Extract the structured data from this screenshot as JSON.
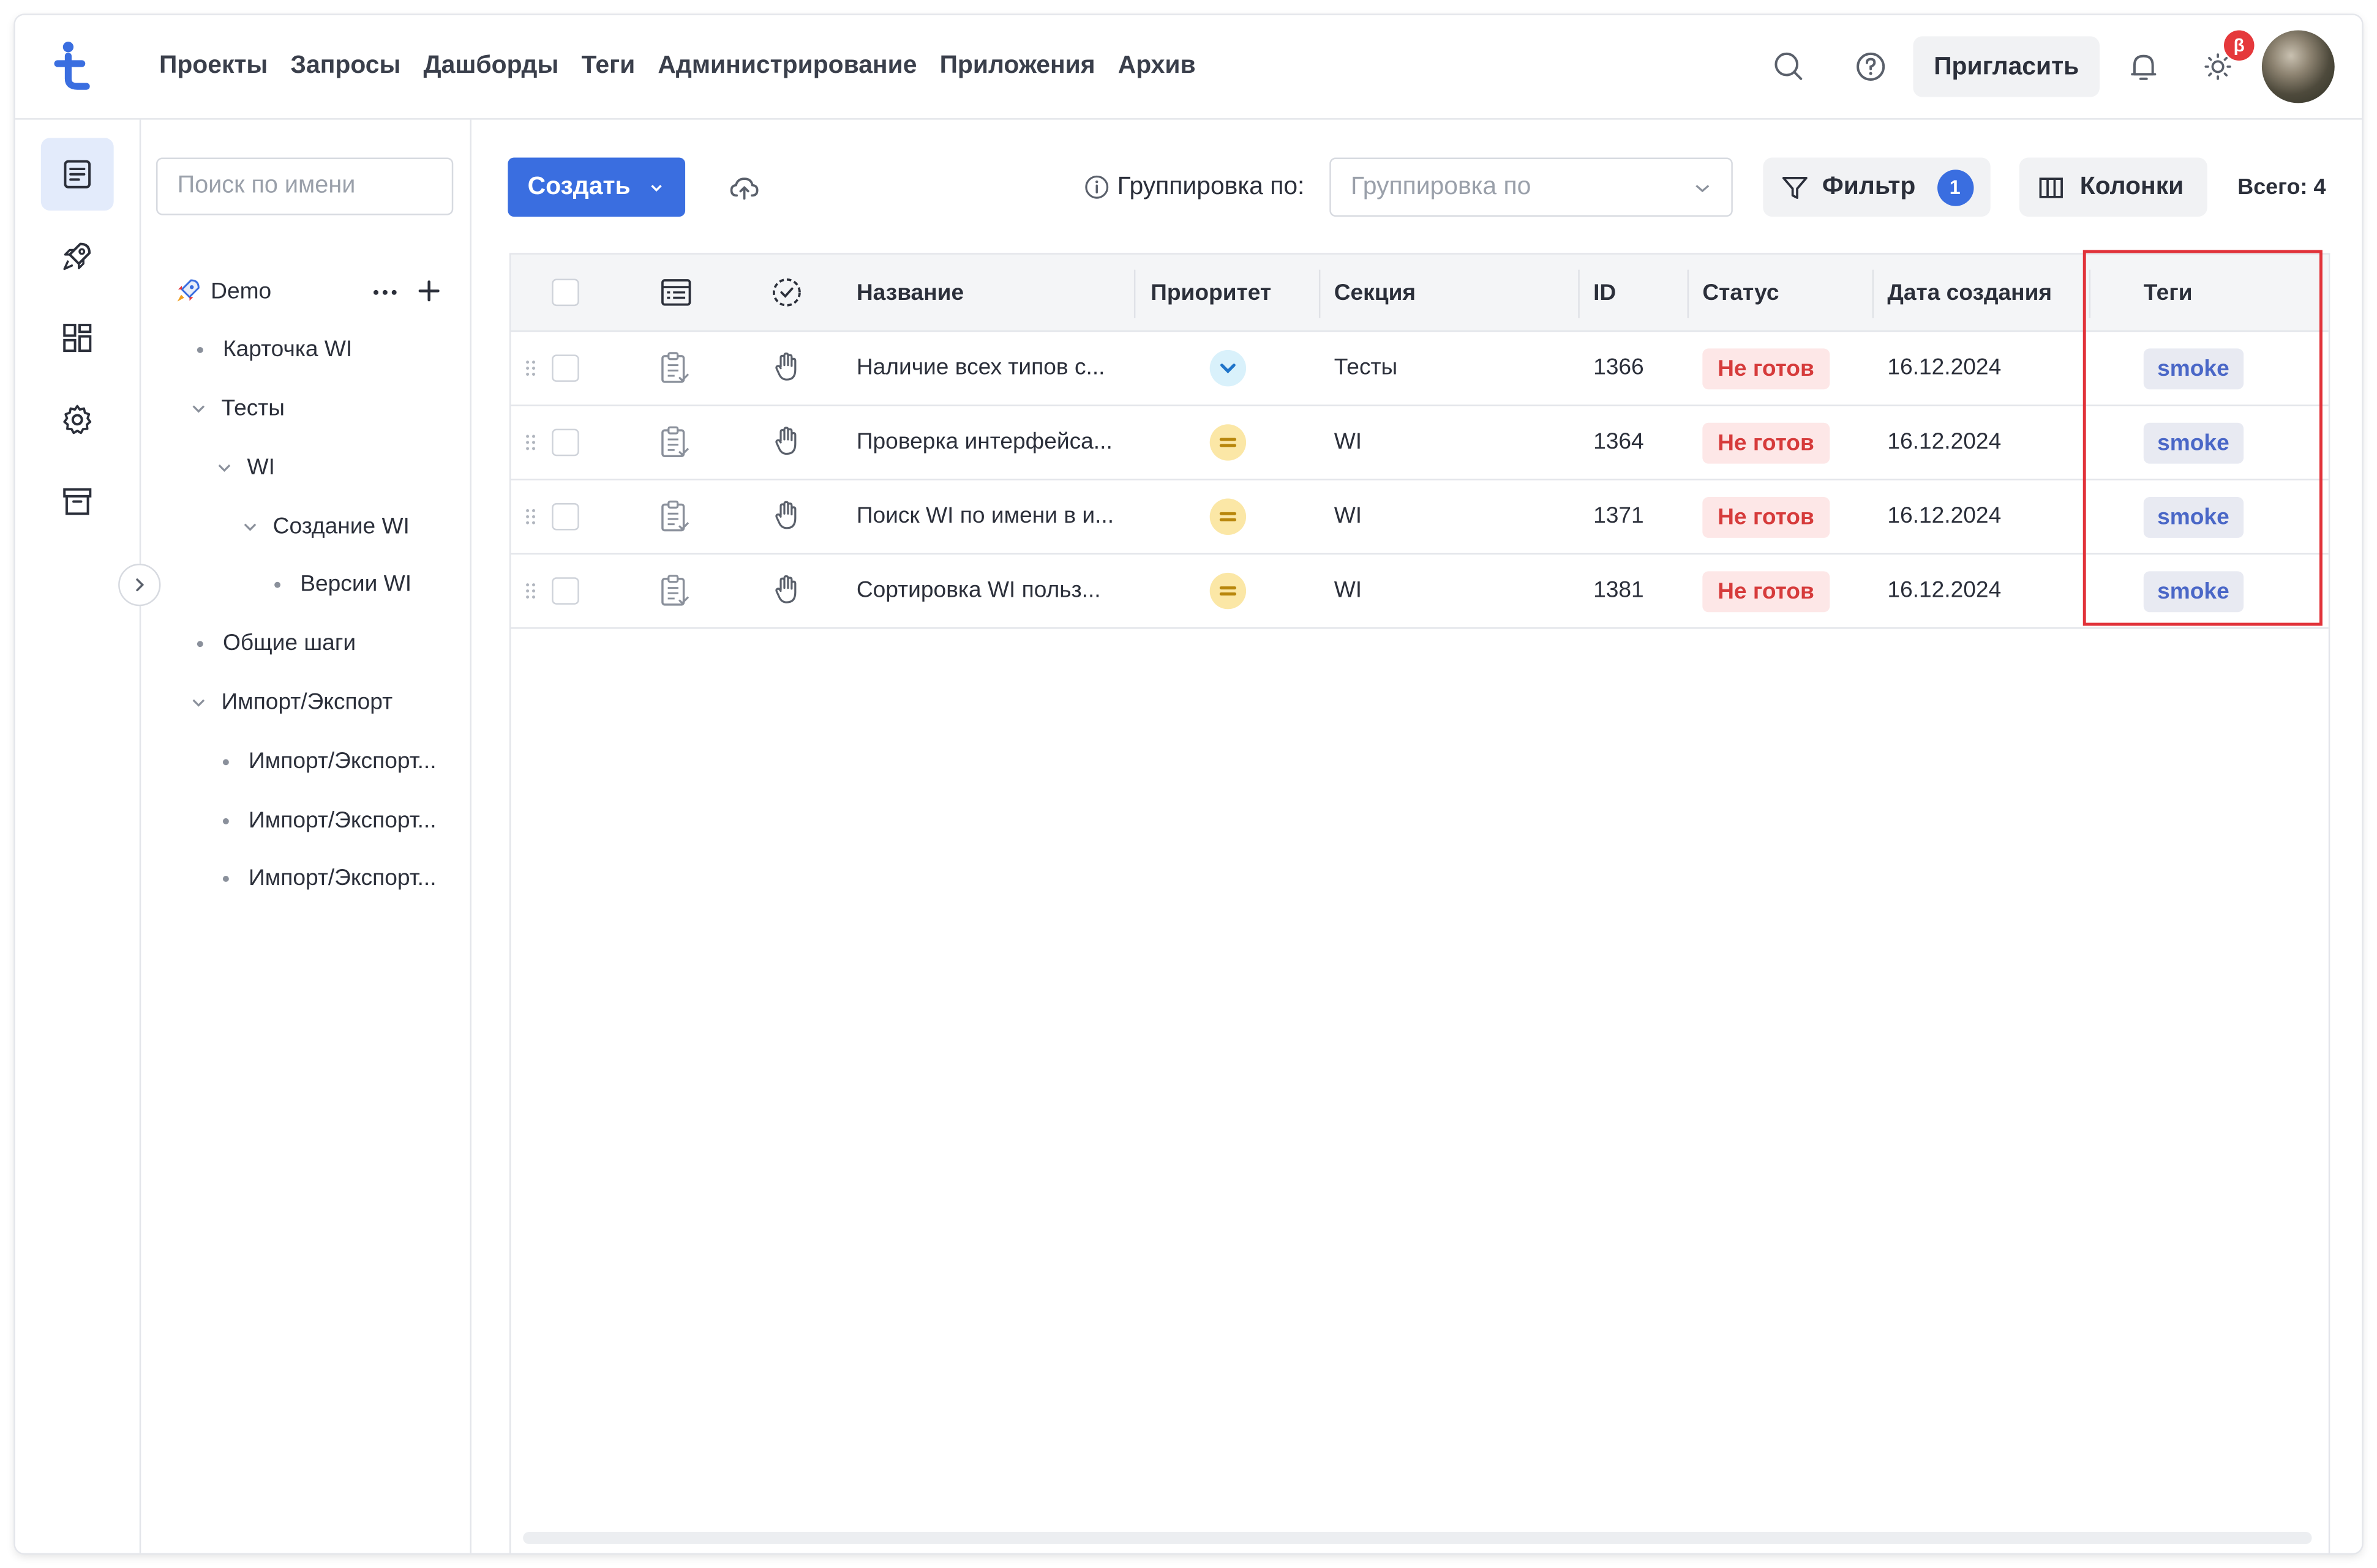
{
  "nav": {
    "items": [
      "Проекты",
      "Запросы",
      "Дашборды",
      "Теги",
      "Администрирование",
      "Приложения",
      "Архив"
    ],
    "invite_label": "Пригласить",
    "beta_badge": "β"
  },
  "tree": {
    "search_placeholder": "Поиск по имени",
    "project": "Demo",
    "items": [
      {
        "label": "Карточка WI",
        "type": "leaf"
      },
      {
        "label": "Тесты",
        "type": "expanded"
      },
      {
        "label": "WI",
        "type": "expanded"
      },
      {
        "label": "Создание WI",
        "type": "expanded"
      },
      {
        "label": "Версии WI",
        "type": "leaf"
      },
      {
        "label": "Общие шаги",
        "type": "leaf"
      },
      {
        "label": "Импорт/Экспорт",
        "type": "expanded"
      },
      {
        "label": "Импорт/Экспорт...",
        "type": "leaf"
      },
      {
        "label": "Импорт/Экспорт...",
        "type": "leaf"
      },
      {
        "label": "Импорт/Экспорт...",
        "type": "leaf"
      }
    ]
  },
  "toolbar": {
    "create_label": "Создать",
    "group_label": "Группировка по:",
    "group_placeholder": "Группировка по",
    "filter_label": "Фильтр",
    "filter_count": "1",
    "columns_label": "Колонки",
    "total": "Всего: 4"
  },
  "table": {
    "columns": [
      "Название",
      "Приоритет",
      "Секция",
      "ID",
      "Статус",
      "Дата создания",
      "Теги"
    ],
    "rows": [
      {
        "name": "Наличие всех типов с...",
        "priority": "low",
        "section": "Тесты",
        "id": "1366",
        "status": "Не готов",
        "date": "16.12.2024",
        "tag": "smoke"
      },
      {
        "name": "Проверка интерфейса...",
        "priority": "medium",
        "section": "WI",
        "id": "1364",
        "status": "Не готов",
        "date": "16.12.2024",
        "tag": "smoke"
      },
      {
        "name": "Поиск WI по имени в и...",
        "priority": "medium",
        "section": "WI",
        "id": "1371",
        "status": "Не готов",
        "date": "16.12.2024",
        "tag": "smoke"
      },
      {
        "name": "Сортировка WI польз...",
        "priority": "medium",
        "section": "WI",
        "id": "1381",
        "status": "Не готов",
        "date": "16.12.2024",
        "tag": "smoke"
      }
    ]
  },
  "colors": {
    "accent": "#3a6ee0",
    "status_red": "#d63b3b",
    "priority_low": "#d9f1fb",
    "priority_medium": "#fbe7a6",
    "highlight": "#e1323a"
  }
}
